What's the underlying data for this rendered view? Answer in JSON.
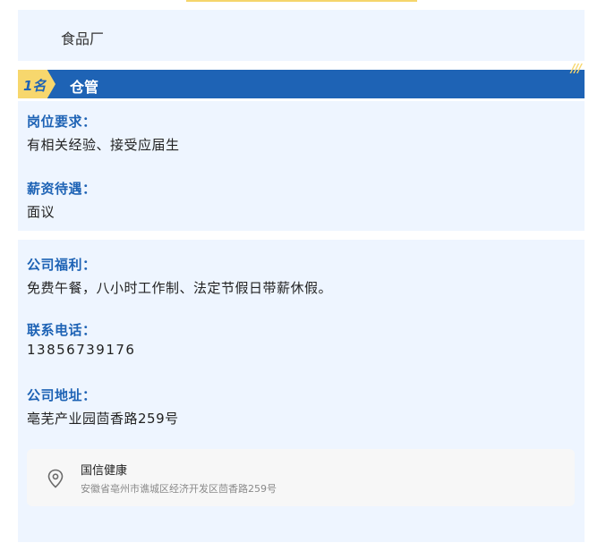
{
  "company": {
    "name": "食品厂"
  },
  "job": {
    "count": "1名",
    "title": "仓管",
    "decor": "///"
  },
  "requirements": {
    "req_label": "岗位要求：",
    "req_value": "有相关经验、接受应届生",
    "salary_label": "薪资待遇：",
    "salary_value": "面议"
  },
  "benefits": {
    "welfare_label": "公司福利：",
    "welfare_value": "免费午餐，八小时工作制、法定节假日带薪休假。",
    "phone_label": "联系电话：",
    "phone_value": "13856739176",
    "address_label": "公司地址：",
    "address_value": "亳芜产业园茴香路259号"
  },
  "location_card": {
    "icon": "location-pin-icon",
    "name": "国信健康",
    "address": "安徽省亳州市谯城区经济开发区茴香路259号"
  },
  "colors": {
    "primary_blue": "#1e63b5",
    "accent_yellow": "#f7d76d",
    "panel_bg": "#eef5ff"
  }
}
